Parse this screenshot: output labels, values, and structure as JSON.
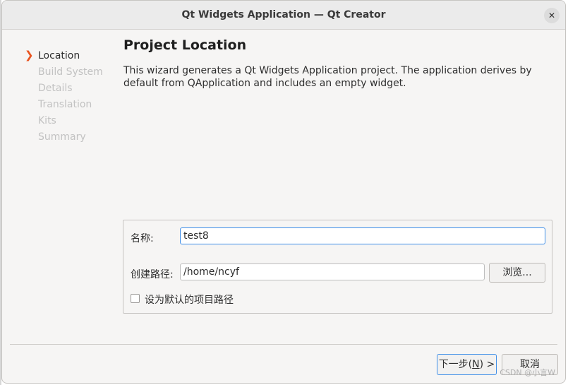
{
  "window": {
    "title": "Qt Widgets Application — Qt Creator",
    "close_symbol": "✕"
  },
  "steps": [
    {
      "label": "Location",
      "active": true
    },
    {
      "label": "Build System",
      "active": false
    },
    {
      "label": "Details",
      "active": false
    },
    {
      "label": "Translation",
      "active": false
    },
    {
      "label": "Kits",
      "active": false
    },
    {
      "label": "Summary",
      "active": false
    }
  ],
  "step_arrow": "❯",
  "page": {
    "title": "Project Location",
    "description": "This wizard generates a Qt Widgets Application project. The application derives by default from QApplication and includes an empty widget."
  },
  "form": {
    "name_label": "名称:",
    "name_value": "test8",
    "path_label": "创建路径:",
    "path_value": "/home/ncyf",
    "browse_button": "浏览...",
    "default_path_checkbox": "设为默认的项目路径",
    "default_path_checked": false
  },
  "buttons": {
    "next_prefix": "下一步(",
    "next_mnemonic": "N",
    "next_suffix": ") >",
    "cancel": "取消"
  },
  "watermark": "CSDN @小言W",
  "colors": {
    "accent_arrow": "#e95420",
    "focus_border": "#3d8ee8",
    "inactive_step": "#c2c2c2"
  }
}
